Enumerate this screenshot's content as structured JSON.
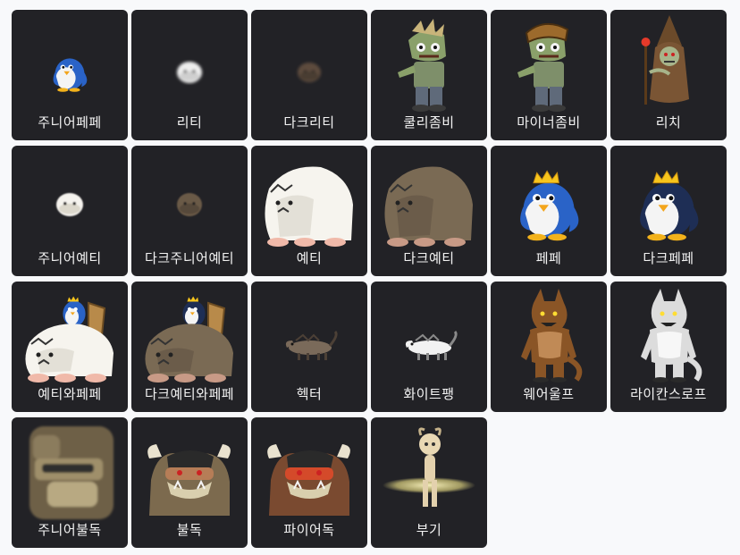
{
  "monsters": [
    {
      "name": "주니어페페",
      "icon": "junior-pepe-icon"
    },
    {
      "name": "리티",
      "icon": "leatty-icon"
    },
    {
      "name": "다크리티",
      "icon": "dark-leatty-icon"
    },
    {
      "name": "쿨리좀비",
      "icon": "coolie-zombie-icon"
    },
    {
      "name": "마이너좀비",
      "icon": "miner-zombie-icon"
    },
    {
      "name": "리치",
      "icon": "lich-icon"
    },
    {
      "name": "주니어예티",
      "icon": "junior-yeti-icon"
    },
    {
      "name": "다크주니어예티",
      "icon": "dark-junior-yeti-icon"
    },
    {
      "name": "예티",
      "icon": "yeti-icon"
    },
    {
      "name": "다크예티",
      "icon": "dark-yeti-icon"
    },
    {
      "name": "페페",
      "icon": "pepe-icon"
    },
    {
      "name": "다크페페",
      "icon": "dark-pepe-icon"
    },
    {
      "name": "예티와페페",
      "icon": "yeti-and-pepe-icon"
    },
    {
      "name": "다크예티와페페",
      "icon": "dark-yeti-and-pepe-icon"
    },
    {
      "name": "헥터",
      "icon": "hector-icon"
    },
    {
      "name": "화이트팽",
      "icon": "white-fang-icon"
    },
    {
      "name": "웨어울프",
      "icon": "werewolf-icon"
    },
    {
      "name": "라이칸스로프",
      "icon": "lycanthrope-icon"
    },
    {
      "name": "주니어불독",
      "icon": "junior-bulldog-icon"
    },
    {
      "name": "불독",
      "icon": "bulldog-icon"
    },
    {
      "name": "파이어독",
      "icon": "firedog-icon"
    },
    {
      "name": "부기",
      "icon": "boogie-icon"
    }
  ]
}
